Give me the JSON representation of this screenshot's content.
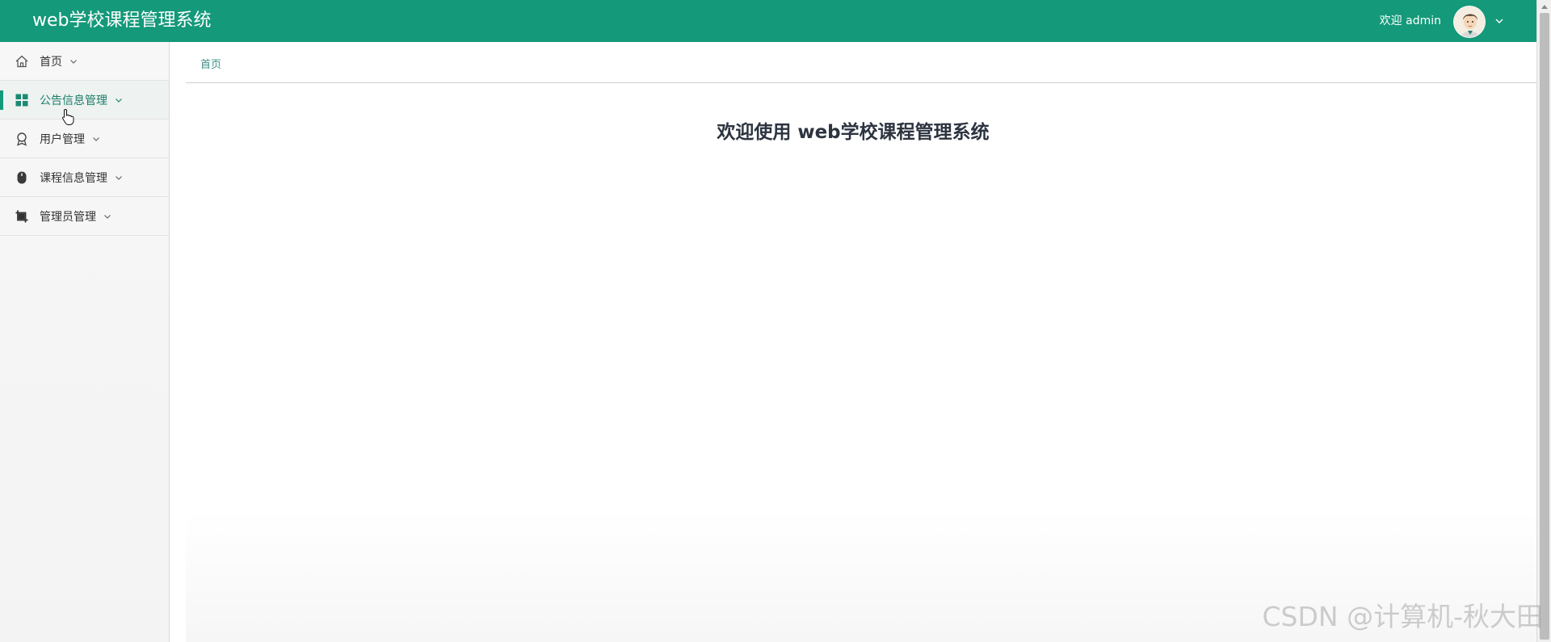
{
  "header": {
    "title": "web学校课程管理系统",
    "welcome": "欢迎 admin",
    "avatar_icon": "user-avatar-icon",
    "menu_chevron_icon": "chevron-down-icon",
    "brand_color": "#14997a"
  },
  "sidebar": {
    "items": [
      {
        "label": "首页",
        "icon": "home-icon"
      },
      {
        "label": "公告信息管理",
        "icon": "grid-icon",
        "active": true
      },
      {
        "label": "用户管理",
        "icon": "award-icon"
      },
      {
        "label": "课程信息管理",
        "icon": "mouse-icon"
      },
      {
        "label": "管理员管理",
        "icon": "crop-icon"
      }
    ]
  },
  "breadcrumb": {
    "current": "首页"
  },
  "main": {
    "heading": "欢迎使用 web学校课程管理系统"
  },
  "watermark": "CSDN @计算机-秋大田"
}
